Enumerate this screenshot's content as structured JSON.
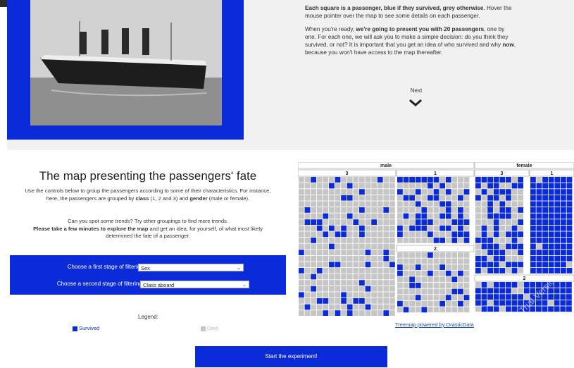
{
  "intro": {
    "p1_bold": "Each square is a passenger, blue if they survived, grey otherwise",
    "p1_rest": ". Hover the mouse pointer over the map to see some details on each passenger.",
    "p2_a": "When you're ready, ",
    "p2_bold": "we're going to present you with 20 passengers",
    "p2_b": ", one by one. For each one, we will ask you to make a simple decision: do you think they survived, or not? It is important that you get an idea of who survived and why ",
    "p2_bold2": "now",
    "p2_c": ", because you won't have access to the map thereafter.",
    "next_label": "Next"
  },
  "section": {
    "title": "The map presenting the passengers' fate",
    "info1_a": "Use the controls below to group the passengers according to some of their characteristics. For instance, here, the passengers are grouped by ",
    "info1_b1": "class",
    "info1_c": " (1, 2 and 3) and ",
    "info1_b2": "gender",
    "info1_d": " (male or female).",
    "info2_a": "Can you spot some trends? Try other groupings to find more trends.",
    "info2_bold": "Please take a few minutes to explore the map",
    "info2_b": " and get an idea, for yourself, of what most likely determined the fate of a passenger."
  },
  "filters": {
    "first_label": "Choose a first stage of filtering:",
    "first_value": "Sex",
    "second_label": "Choose a second stage of filtering:",
    "second_value": "Class aboard"
  },
  "legend": {
    "title": "Legend:",
    "survived": "Survived",
    "died": "Died",
    "survived_color": "#0b2bd8",
    "died_color": "#c6c6c6"
  },
  "treemap": {
    "groups": [
      "male",
      "female"
    ],
    "male_classes": [
      "3",
      "1",
      "2"
    ],
    "female_classes": [
      "3",
      "1",
      "2"
    ],
    "watermark": "Trial Version",
    "credit": "Treemap powered by DrasticData"
  },
  "cta": {
    "start_label": "Start the experiment!"
  }
}
